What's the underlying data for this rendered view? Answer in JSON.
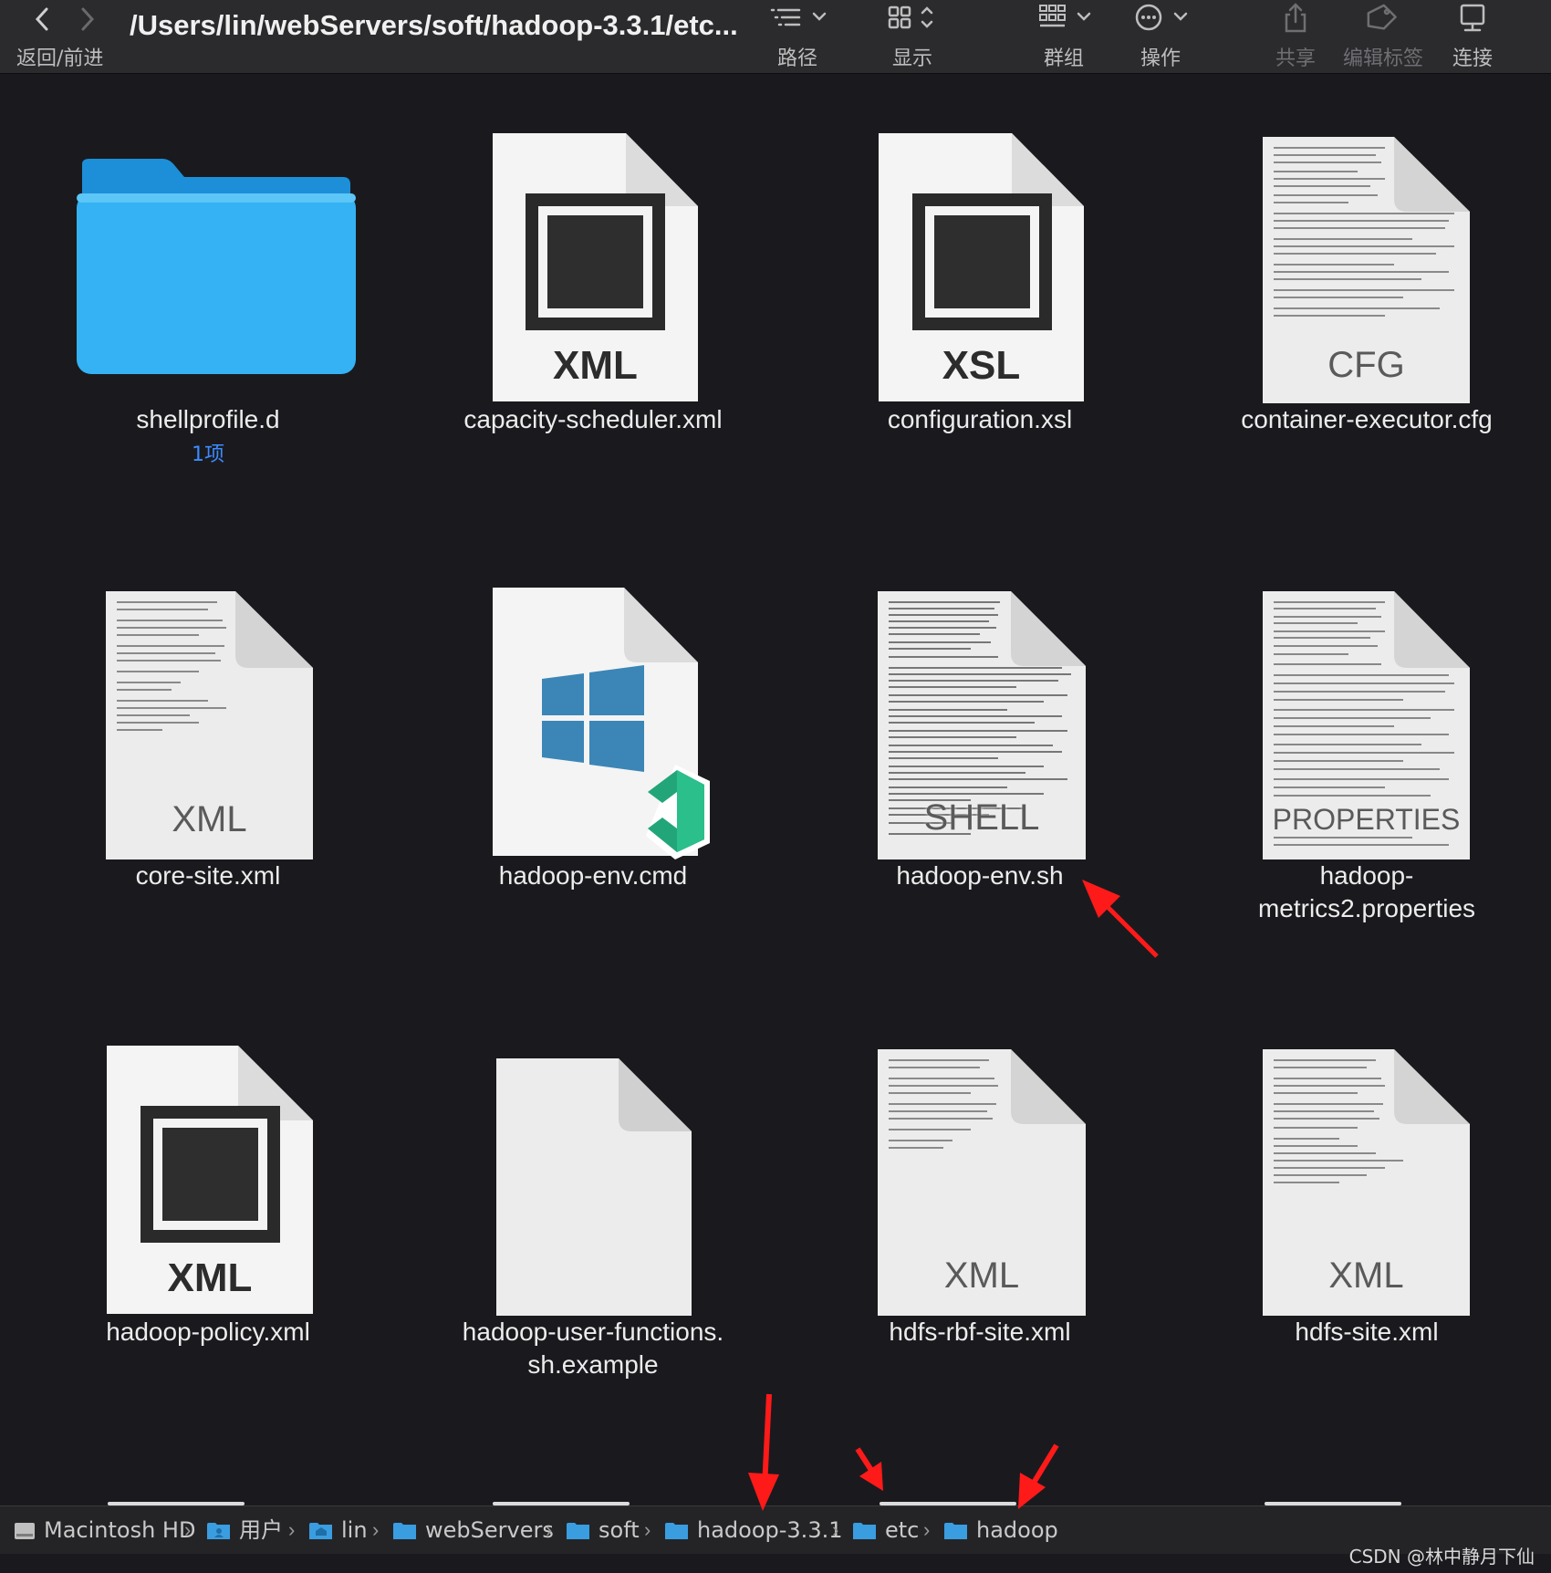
{
  "toolbar": {
    "nav_label": "返回/前进",
    "path_title": "/Users/lin/webServers/soft/hadoop-3.3.1/etc...",
    "tools": {
      "path": "路径",
      "view": "显示",
      "group": "群组",
      "action": "操作",
      "share": "共享",
      "tags": "编辑标签",
      "connect": "连接"
    }
  },
  "files": [
    {
      "name": "shellprofile.d",
      "sub": "1项",
      "kind": "folder"
    },
    {
      "name": "capacity-scheduler.xml",
      "kind": "xml-doc",
      "badge": "XML"
    },
    {
      "name": "configuration.xsl",
      "kind": "xml-doc",
      "badge": "XSL"
    },
    {
      "name": "container-executor.cfg",
      "kind": "text-doc",
      "badge": "CFG"
    },
    {
      "name": "core-site.xml",
      "kind": "text-doc",
      "badge": "XML"
    },
    {
      "name": "hadoop-env.cmd",
      "kind": "vscode-cmd"
    },
    {
      "name": "hadoop-env.sh",
      "kind": "text-doc",
      "badge": "SHELL"
    },
    {
      "name": "hadoop-metrics2.properties",
      "kind": "text-doc",
      "badge": "PROPERTIES"
    },
    {
      "name": "hadoop-policy.xml",
      "kind": "xml-doc",
      "badge": "XML"
    },
    {
      "name": "hadoop-user-functions.sh.example",
      "kind": "blank-doc"
    },
    {
      "name": "hdfs-rbf-site.xml",
      "kind": "text-doc",
      "badge": "XML"
    },
    {
      "name": "hdfs-site.xml",
      "kind": "text-doc",
      "badge": "XML"
    }
  ],
  "pathbar": [
    "Macintosh HD",
    "用户",
    "lin",
    "webServers",
    "soft",
    "hadoop-3.3.1",
    "etc",
    "hadoop"
  ],
  "watermark": "CSDN @林中静月下仙",
  "colors": {
    "background": "#1a1a1e",
    "folder": "#2ba8ee",
    "annotation_arrow": "#ff1a1a",
    "sub_text": "#3c8bff"
  }
}
